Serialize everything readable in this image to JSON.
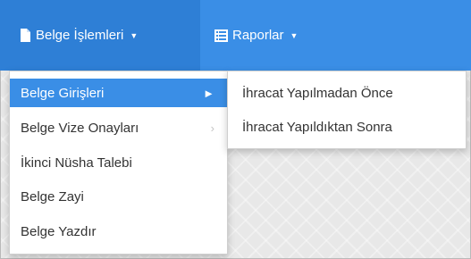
{
  "colors": {
    "navbar": "#3a8ee6",
    "navbar_active": "#2e7fd6",
    "highlight": "#3a8ee6"
  },
  "navbar": {
    "items": [
      {
        "label": "Belge İşlemleri",
        "icon": "document-icon"
      },
      {
        "label": "Raporlar",
        "icon": "list-icon"
      }
    ]
  },
  "menu": {
    "items": [
      {
        "label": "Belge Girişleri"
      },
      {
        "label": "Belge Vize Onayları"
      },
      {
        "label": "İkinci Nüsha Talebi"
      },
      {
        "label": "Belge Zayi"
      },
      {
        "label": "Belge Yazdır"
      }
    ]
  },
  "submenu": {
    "items": [
      {
        "label": "İhracat Yapılmadan Önce"
      },
      {
        "label": "İhracat Yapıldıktan Sonra"
      }
    ]
  }
}
